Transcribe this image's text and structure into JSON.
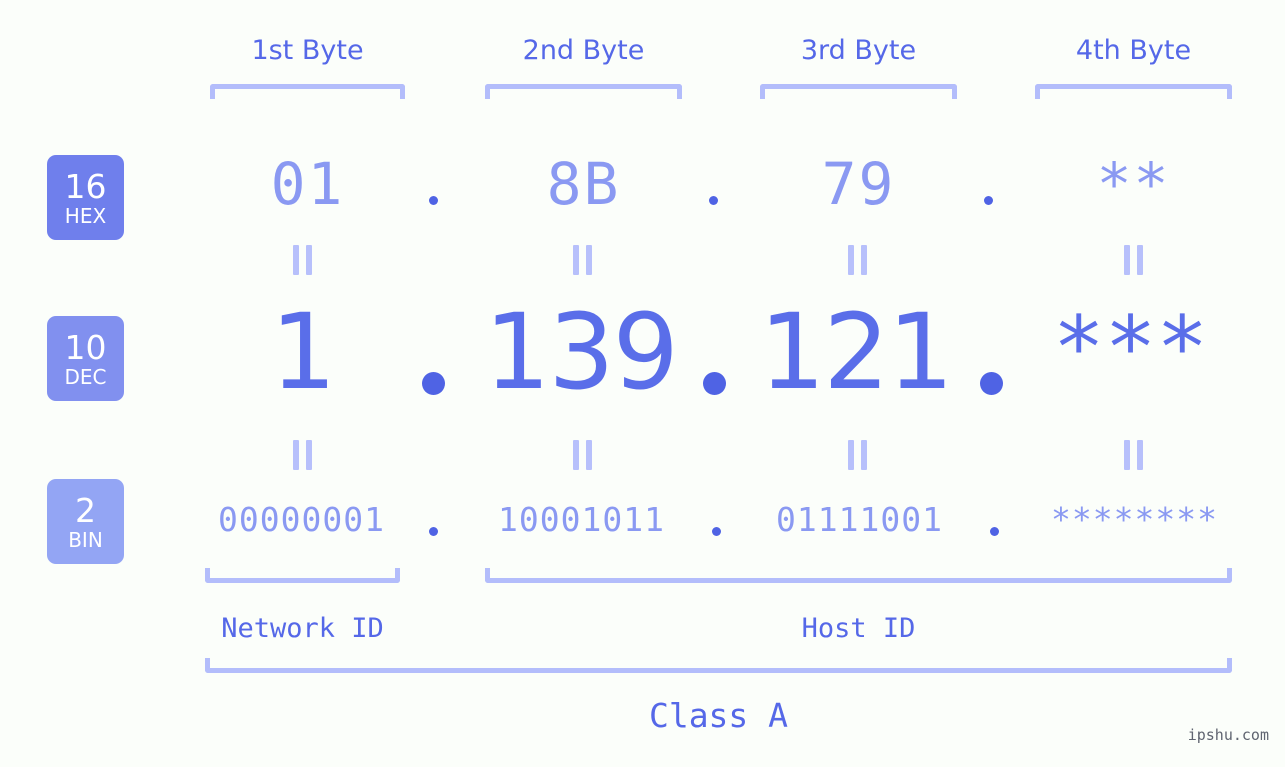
{
  "page": {
    "background_color": "#fbfefa",
    "accent_color": "#5568e8",
    "light_accent_color": "#b3bdfb",
    "muted_value_color": "#8a99f2"
  },
  "byte_headers": [
    {
      "label": "1st Byte"
    },
    {
      "label": "2nd Byte"
    },
    {
      "label": "3rd Byte"
    },
    {
      "label": "4th Byte"
    }
  ],
  "bases": [
    {
      "number": "16",
      "name": "HEX",
      "color": "#6f7fec"
    },
    {
      "number": "10",
      "name": "DEC",
      "color": "#8190ef"
    },
    {
      "number": "2",
      "name": "BIN",
      "color": "#93a5f4"
    }
  ],
  "rows": {
    "hex": {
      "base_number": "16",
      "base_name": "HEX",
      "values": [
        "01",
        "8B",
        "79",
        "**"
      ],
      "separator": "."
    },
    "dec": {
      "base_number": "10",
      "base_name": "DEC",
      "values": [
        "1",
        "139",
        "121",
        "***"
      ],
      "separator": "."
    },
    "bin": {
      "base_number": "2",
      "base_name": "BIN",
      "values": [
        "00000001",
        "10001011",
        "01111001",
        "********"
      ],
      "separator": "."
    }
  },
  "equivalence_marker": "||",
  "sections": {
    "network_id": "Network ID",
    "host_id": "Host ID",
    "class": "Class A"
  },
  "watermark": "ipshu.com"
}
